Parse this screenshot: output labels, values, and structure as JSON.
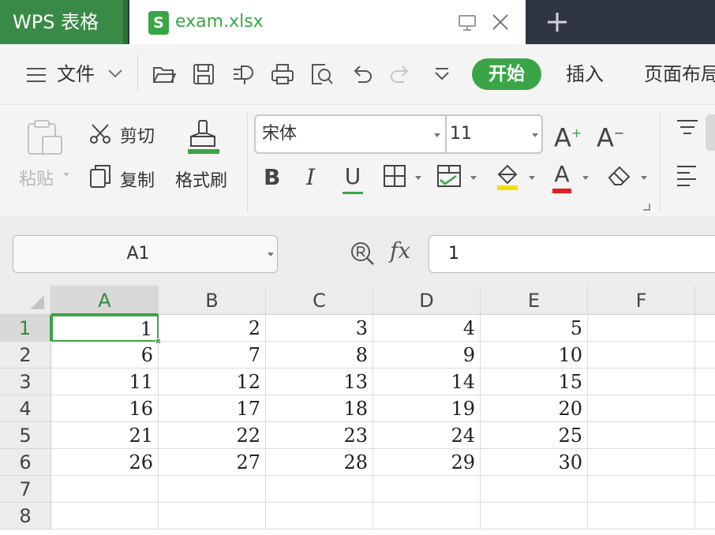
{
  "titlebar": {
    "app_name": "WPS 表格",
    "document_name": "exam.xlsx",
    "doc_icon_letter": "S",
    "accent_color": "#3aa546",
    "icons": [
      "monitor-icon",
      "close-icon",
      "plus-icon"
    ]
  },
  "menubar": {
    "file_label": "文件",
    "start_label": "开始",
    "insert_label": "插入",
    "page_layout_label": "页面布局",
    "icons": [
      "menu-icon",
      "chevron-down-icon",
      "open-folder-icon",
      "save-icon",
      "export-icon",
      "print-icon",
      "print-preview-icon",
      "undo-icon",
      "redo-icon",
      "customize-icon"
    ]
  },
  "ribbon": {
    "paste_label": "粘贴",
    "cut_label": "剪切",
    "copy_label": "复制",
    "format_painter_label": "格式刷",
    "font_name": "宋体",
    "font_size": "11",
    "bold": "B",
    "italic": "I",
    "underline": "U",
    "font_color_letter": "A",
    "font_color": "#e02020",
    "fill_color": "#f2e000",
    "increase_font": "A",
    "decrease_font": "A",
    "increase_mark": "+",
    "decrease_mark": "−"
  },
  "formula_bar": {
    "cell_reference": "A1",
    "fx_label": "fx",
    "value": "1"
  },
  "sheet": {
    "columns": [
      "A",
      "B",
      "C",
      "D",
      "E",
      "F"
    ],
    "rows": [
      "1",
      "2",
      "3",
      "4",
      "5",
      "6",
      "7",
      "8"
    ],
    "selected_cell": "A1",
    "cells": [
      [
        "1",
        "2",
        "3",
        "4",
        "5",
        ""
      ],
      [
        "6",
        "7",
        "8",
        "9",
        "10",
        ""
      ],
      [
        "11",
        "12",
        "13",
        "14",
        "15",
        ""
      ],
      [
        "16",
        "17",
        "18",
        "19",
        "20",
        ""
      ],
      [
        "21",
        "22",
        "23",
        "24",
        "25",
        ""
      ],
      [
        "26",
        "27",
        "28",
        "29",
        "30",
        ""
      ],
      [
        "",
        "",
        "",
        "",
        "",
        ""
      ],
      [
        "",
        "",
        "",
        "",
        "",
        ""
      ]
    ]
  }
}
